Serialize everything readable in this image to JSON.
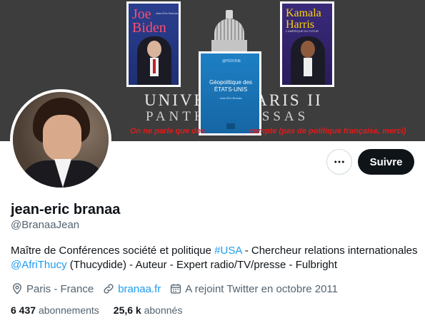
{
  "banner": {
    "book_left_title_1": "Joe",
    "book_left_title_2": "Biden",
    "book_left_author": "Jean-Éric Branaa",
    "book_right_title_1": "Kamala",
    "book_right_title_2": "Harris",
    "book_right_subtitle": "L'AMÉRIQUE DU FUTUR",
    "book_center_logo": "@PÉDONE",
    "book_center_title": "Géopolitique des ÉTATS-UNIS",
    "book_center_author": "Jean-Éric Branaa",
    "university_line1": "UNIVE        ARIS II",
    "university_line2": "PANTH      ASSAS",
    "note": "On ne parle que des                    compte (pas de politique française, merci)"
  },
  "profile": {
    "display_name": "jean-eric branaa",
    "handle": "@BranaaJean",
    "bio_part1": "Maître de Conférences société et politique ",
    "bio_hashtag": "#USA",
    "bio_part2": " - Chercheur relations internationales ",
    "bio_mention": "@AfriThucy",
    "bio_part3": " (Thucydide) - Auteur - Expert radio/TV/presse - Fulbright",
    "location": "Paris - France",
    "website": "branaa.fr",
    "joined": "A rejoint Twitter en octobre 2011"
  },
  "actions": {
    "follow_label": "Suivre"
  },
  "stats": {
    "following_count": "6 437",
    "following_label": "abonnements",
    "followers_count": "25,6 k",
    "followers_label": "abonnés"
  },
  "colors": {
    "accent": "#1d9bf0",
    "text_primary": "#0f1419",
    "text_secondary": "#536471",
    "banner_note": "#e21b1b"
  },
  "icons": {
    "more": "more-horizontal-icon",
    "location": "location-pin-icon",
    "website": "link-icon",
    "joined": "calendar-icon"
  }
}
